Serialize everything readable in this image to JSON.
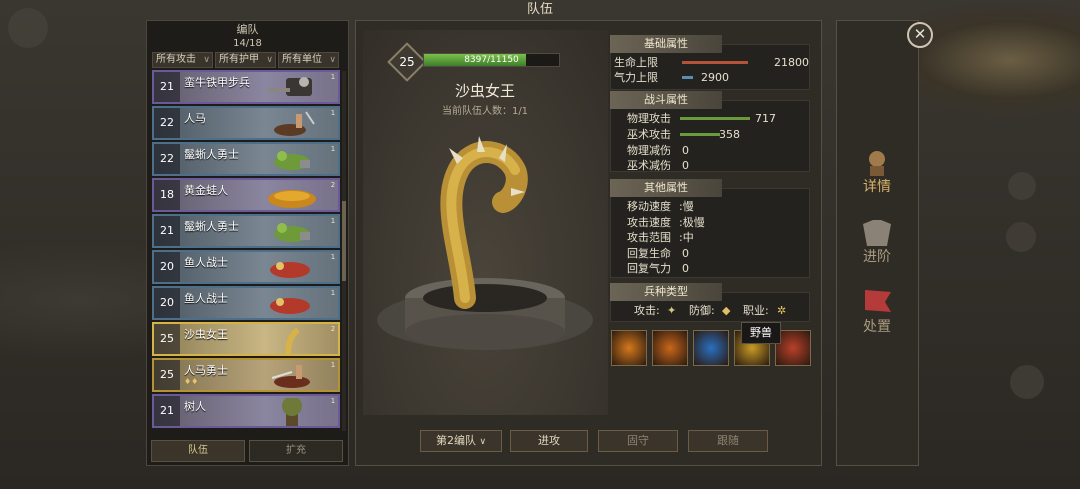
{
  "window": {
    "title": "队伍"
  },
  "left_panel": {
    "title": "编队",
    "count": "14/18",
    "filters": [
      "所有攻击",
      "所有护甲",
      "所有单位"
    ],
    "units": [
      {
        "level": "21",
        "name": "蛮牛铁甲步兵",
        "rarity": "purple",
        "badge": "1"
      },
      {
        "level": "22",
        "name": "人马",
        "rarity": "blue",
        "badge": "1"
      },
      {
        "level": "22",
        "name": "鬣蜥人勇士",
        "rarity": "blue",
        "badge": "1"
      },
      {
        "level": "18",
        "name": "黄金蛙人",
        "rarity": "purple",
        "badge": "2"
      },
      {
        "level": "21",
        "name": "鬣蜥人勇士",
        "rarity": "blue",
        "badge": "1"
      },
      {
        "level": "20",
        "name": "鱼人战士",
        "rarity": "blue",
        "badge": "1"
      },
      {
        "level": "20",
        "name": "鱼人战士",
        "rarity": "blue",
        "badge": "1"
      },
      {
        "level": "25",
        "name": "沙虫女王",
        "rarity": "selected",
        "badge": "2"
      },
      {
        "level": "25",
        "name": "人马勇士",
        "rarity": "gold",
        "badge": "1"
      },
      {
        "level": "21",
        "name": "树人",
        "rarity": "purple",
        "badge": "1"
      }
    ],
    "tabs": [
      "队伍",
      "扩充"
    ]
  },
  "unit_detail": {
    "level": "25",
    "hp_text": "8397/11150",
    "hp_fraction": 0.753,
    "name": "沙虫女王",
    "team_count": "当前队伍人数：1/1"
  },
  "stats": {
    "basic": {
      "header": "基础属性",
      "rows": [
        {
          "label": "生命上限",
          "value": "21800",
          "fraction": 0.75,
          "color": "#b5523a"
        },
        {
          "label": "气力上限",
          "value": "2900",
          "fraction": 0.12,
          "color": "#5a8db0"
        }
      ]
    },
    "combat": {
      "header": "战斗属性",
      "rows": [
        {
          "label": "物理攻击",
          "value": "717",
          "fraction": 0.8,
          "color": "#6a9a3a"
        },
        {
          "label": "巫术攻击",
          "value": "358",
          "fraction": 0.45,
          "color": "#6a9a3a"
        },
        {
          "label": "物理减伤",
          "value": "0"
        },
        {
          "label": "巫术减伤",
          "value": "0"
        }
      ]
    },
    "other": {
      "header": "其他属性",
      "rows": [
        {
          "label": "移动速度",
          "value": ":慢"
        },
        {
          "label": "攻击速度",
          "value": ":极慢"
        },
        {
          "label": "攻击范围",
          "value": ":中"
        },
        {
          "label": "回复生命",
          "value": "0"
        },
        {
          "label": "回复气力",
          "value": "0"
        }
      ]
    },
    "type": {
      "header": "兵种类型",
      "attack_label": "攻击:",
      "defense_label": "防御:",
      "class_label": "职业:"
    }
  },
  "tooltip": "野兽",
  "skills": [
    {
      "icon": "tornado-skill-icon",
      "color": "#d4781c"
    },
    {
      "icon": "claw-skill-icon",
      "color": "#c9661a"
    },
    {
      "icon": "orb-skill-icon",
      "color": "#2a6fc0"
    },
    {
      "icon": "star-skill-icon",
      "color": "#c79a25"
    },
    {
      "icon": "bomb-skill-icon",
      "color": "#b8402a"
    }
  ],
  "buttons": {
    "team_select": "第2编队",
    "attack": "进攻",
    "defend": "固守",
    "follow": "跟随"
  },
  "right_nav": {
    "details": "详情",
    "advance": "进阶",
    "dismiss": "处置"
  }
}
